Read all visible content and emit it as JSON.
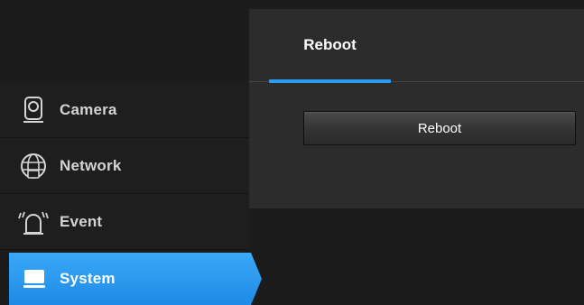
{
  "sidebar": {
    "items": [
      {
        "label": "Camera",
        "icon": "camera-icon",
        "active": false
      },
      {
        "label": "Network",
        "icon": "network-globe-icon",
        "active": false
      },
      {
        "label": "Event",
        "icon": "alarm-icon",
        "active": false
      },
      {
        "label": "System",
        "icon": "monitor-icon",
        "active": true
      }
    ]
  },
  "content": {
    "tabs": [
      {
        "label": "Reboot",
        "active": true
      }
    ],
    "reboot_button_label": "Reboot"
  },
  "colors": {
    "accent": "#2d9bf0",
    "sidebar_bg": "#1e1e1e",
    "panel_bg": "#2c2c2c",
    "page_bg": "#1b1b1b"
  }
}
